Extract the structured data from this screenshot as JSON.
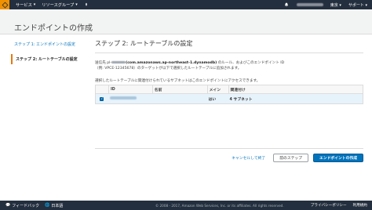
{
  "topnav": {
    "services_label": "サービス",
    "resource_groups_label": "リソースグループ",
    "region_label": "東京",
    "support_label": "サポート"
  },
  "page": {
    "title": "エンドポイントの作成"
  },
  "steps": [
    {
      "label": "ステップ 1: エンドポイントの設定"
    },
    {
      "label": "ステップ 2: ルートテーブルの設定"
    }
  ],
  "main": {
    "heading": "ステップ 2: ルートテーブルの設定",
    "desc_part1": "送信先 pl-",
    "desc_bold": "(com.amazonaws.ap-northeast-1.dynamodb)",
    "desc_part2": " のルール、およびこのエンドポイント ID",
    "desc_line2": "（例: VPCE-12345678）のターゲットが以下で選択したルートテーブルに追加されます。",
    "desc2": "選択したルートテーブルに関連付けられているサブネットはこのエンドポイントにアクセスできます。"
  },
  "table": {
    "headers": {
      "id": "ID",
      "name": "名前",
      "main": "メイン",
      "assoc": "関連付け"
    },
    "rows": [
      {
        "main": "はい",
        "assoc": "4 サブネット"
      }
    ]
  },
  "buttons": {
    "cancel": "キャンセルして終了",
    "prev": "前のステップ",
    "create": "エンドポイントの作成"
  },
  "footer": {
    "feedback": "フィードバック",
    "language": "日本語",
    "copyright": "© 2008 - 2017, Amazon Web Services, Inc. or its affiliates. All rights reserved.",
    "privacy": "プライバシーポリシー",
    "terms": "利用規約"
  }
}
